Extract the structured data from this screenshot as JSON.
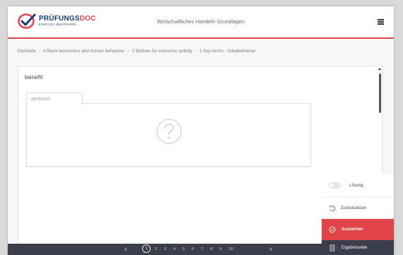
{
  "header": {
    "brand_main": "PRÜFUNGS",
    "brand_accent": "DOC",
    "brand_tagline": "EINFACH BESTEHEN",
    "title": "Wirtschaftliches Handeln Grundlagen"
  },
  "breadcrumb": [
    "Startseite",
    "A Basic economics and human behaviour",
    "1 Motives for economic activity",
    "1 Key terms - Vokabeltrainer"
  ],
  "question": {
    "text": "benefit"
  },
  "answer": {
    "tab_label": "ANTWORT"
  },
  "side_panel": {
    "loesung": "Lösung",
    "reset": "Zurücksetzen",
    "auswerten": "Auswerten",
    "ergebnis": "Ergebnisseite"
  },
  "pager": {
    "prev": "‹",
    "next": "›",
    "current": "1",
    "pages": [
      "2",
      "3",
      "4",
      "5",
      "6",
      "7",
      "8",
      "9",
      "10"
    ]
  },
  "colors": {
    "accent": "#e0434a",
    "brand": "#1d3c78",
    "dark_bar": "#3a3f4b"
  }
}
